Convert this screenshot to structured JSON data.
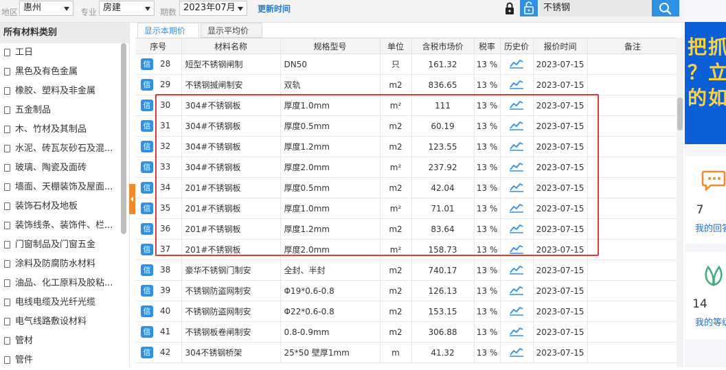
{
  "filters": {
    "region_label": "地区",
    "region_value": "惠州",
    "category_label": "专业",
    "category_value": "房建",
    "period_label": "期数",
    "period_value": "2023年07月",
    "update_label": "更新时间",
    "search_value": "不锈钢"
  },
  "sidebar": {
    "title": "所有材料类别",
    "items": [
      "工日",
      "黑色及有色金属",
      "橡胶、塑料及非金属",
      "五金制品",
      "木、竹材及其制品",
      "水泥、砖瓦灰砂石及混...",
      "玻璃、陶瓷及面砖",
      "墙面、天棚装饰及屋面...",
      "装饰石材及地板",
      "装饰线条、装饰件、栏...",
      "门窗制品及门窗五金",
      "涂料及防腐防水材料",
      "油品、化工原料及胶粘...",
      "电线电缆及光纤光缆",
      "电气线路敷设材料",
      "管材",
      "管件"
    ]
  },
  "tabs": [
    "显示本期价格",
    "显示平均价"
  ],
  "columns": [
    "序号",
    "材料名称",
    "规格型号",
    "单位",
    "含税市场价",
    "税率",
    "历史价",
    "报价时间",
    "备注"
  ],
  "badge_label": "信",
  "rows": [
    {
      "seq": "28",
      "name": "短型不锈钢闸制",
      "spec": "DN50",
      "unit": "只",
      "price": "161.32",
      "tax": "13 %",
      "date": "2023-07-15",
      "note": ""
    },
    {
      "seq": "29",
      "name": "不锈钢揻闸制安",
      "spec": "双轨",
      "unit": "m2",
      "price": "836.65",
      "tax": "13 %",
      "date": "2023-07-15",
      "note": ""
    },
    {
      "seq": "30",
      "name": "304#不锈钢板",
      "spec": "厚度1.0mm",
      "unit": "m²",
      "price": "111",
      "tax": "13 %",
      "date": "2023-07-15",
      "note": ""
    },
    {
      "seq": "31",
      "name": "304#不锈钢板",
      "spec": "厚度0.5mm",
      "unit": "m2",
      "price": "60.19",
      "tax": "13 %",
      "date": "2023-07-15",
      "note": ""
    },
    {
      "seq": "32",
      "name": "304#不锈钢板",
      "spec": "厚度1.2mm",
      "unit": "m2",
      "price": "123.55",
      "tax": "13 %",
      "date": "2023-07-15",
      "note": ""
    },
    {
      "seq": "33",
      "name": "304#不锈钢板",
      "spec": "厚度2.0mm",
      "unit": "m²",
      "price": "237.92",
      "tax": "13 %",
      "date": "2023-07-15",
      "note": ""
    },
    {
      "seq": "34",
      "name": "201#不锈钢板",
      "spec": "厚度0.5mm",
      "unit": "m2",
      "price": "42.04",
      "tax": "13 %",
      "date": "2023-07-15",
      "note": ""
    },
    {
      "seq": "35",
      "name": "201#不锈钢板",
      "spec": "厚度1.0mm",
      "unit": "m²",
      "price": "71.01",
      "tax": "13 %",
      "date": "2023-07-15",
      "note": ""
    },
    {
      "seq": "36",
      "name": "201#不锈钢板",
      "spec": "厚度1.2mm",
      "unit": "m2",
      "price": "83.64",
      "tax": "13 %",
      "date": "2023-07-15",
      "note": ""
    },
    {
      "seq": "37",
      "name": "201#不锈钢板",
      "spec": "厚度2.0mm",
      "unit": "m²",
      "price": "158.73",
      "tax": "13 %",
      "date": "2023-07-15",
      "note": ""
    },
    {
      "seq": "38",
      "name": "豪华不锈钢门制安",
      "spec": "全封、半封",
      "unit": "m2",
      "price": "740.17",
      "tax": "13 %",
      "date": "2023-07-15",
      "note": ""
    },
    {
      "seq": "39",
      "name": "不锈钢防盗网制安",
      "spec": "Φ19*0.6-0.8",
      "unit": "m2",
      "price": "126.13",
      "tax": "13 %",
      "date": "2023-07-15",
      "note": ""
    },
    {
      "seq": "40",
      "name": "不锈钢防盗网制安",
      "spec": "Φ22*0.6-0.8",
      "unit": "m2",
      "price": "153.15",
      "tax": "13 %",
      "date": "2023-07-15",
      "note": ""
    },
    {
      "seq": "41",
      "name": "不锈钢板卷闸制安",
      "spec": "0.8-0.9mm",
      "unit": "m2",
      "price": "306.88",
      "tax": "13 %",
      "date": "2023-07-15",
      "note": ""
    },
    {
      "seq": "42",
      "name": "304不锈钢桥架",
      "spec": "25*50 壁厚1mm",
      "unit": "m",
      "price": "41.32",
      "tax": "13 %",
      "date": "2023-07-15",
      "note": ""
    }
  ],
  "right_panel": {
    "banner_lines": [
      "把抓",
      "？立",
      "的如"
    ],
    "stat1_value": "7",
    "stat1_label": "我的回答",
    "stat2_value": "14",
    "stat2_label": "我的等级"
  },
  "icons": {
    "lock": "lock-icon",
    "unlock": "unlock-icon",
    "search": "search-icon",
    "file": "file-icon",
    "trend": "trend-chart-icon",
    "chat": "chat-bubble-icon",
    "leaf": "leaf-icon"
  },
  "colors": {
    "accent_blue": "#2e91e6",
    "link_blue": "#1d7cd3",
    "highlight_red": "#e23a33",
    "collapse_orange": "#f28a2c",
    "chat_orange": "#f28a2c",
    "leaf_green": "#3bb07a"
  }
}
